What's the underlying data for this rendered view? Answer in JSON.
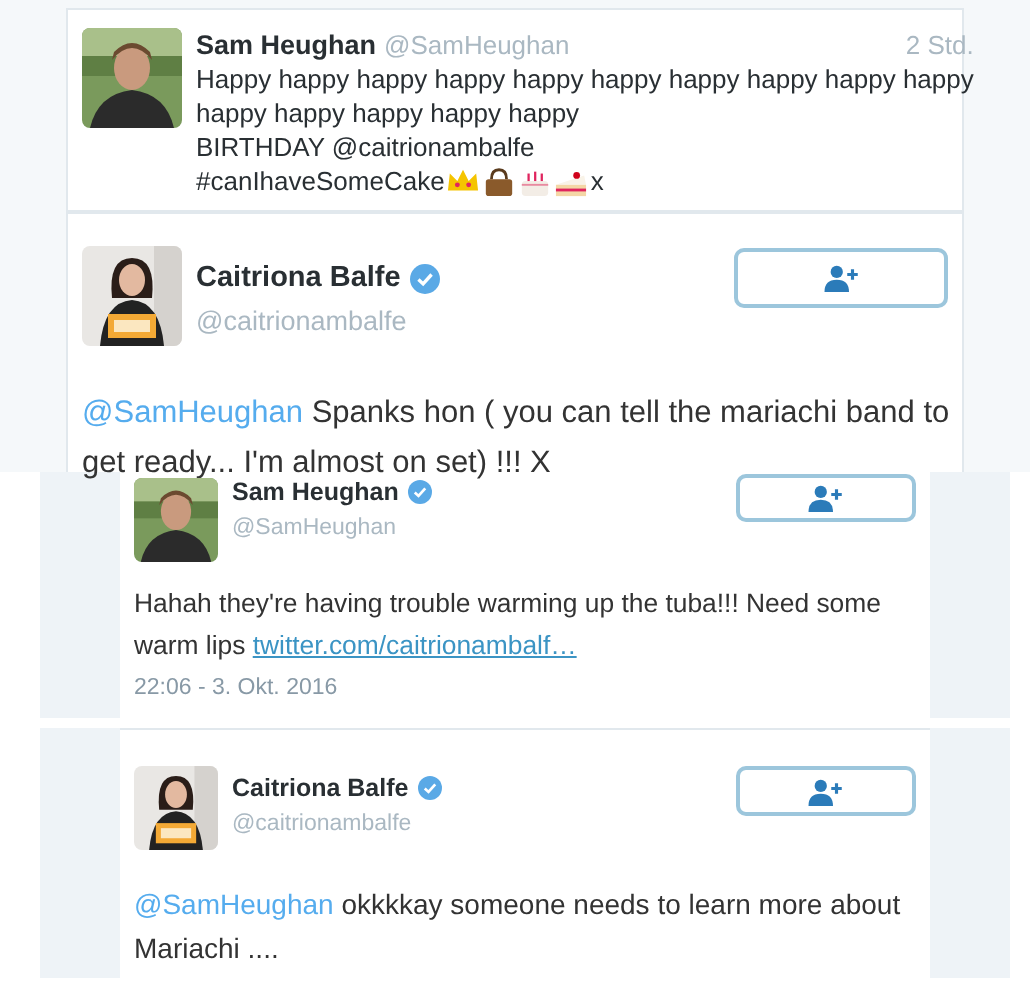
{
  "panels": [
    {
      "kind": "compact",
      "name": "Sam Heughan",
      "handle": "@SamHeughan",
      "time": "2 Std.",
      "lines": [
        "Happy happy happy happy happy happy happy happy happy happy",
        "happy happy happy happy happy",
        "BIRTHDAY @caitrionambalfe",
        "#canIhaveSomeCake"
      ],
      "sign_off": "x"
    },
    {
      "kind": "expanded",
      "name": "Caitriona Balfe",
      "verified": true,
      "handle": "@caitrionambalfe",
      "body": [
        {
          "kind": "mention",
          "text": "@SamHeughan"
        },
        {
          "kind": "plain",
          "text": " Spanks hon ( you can tell the mariachi band to get ready... I'm almost on set) !!! X"
        }
      ]
    },
    {
      "kind": "expanded",
      "name": "Sam Heughan",
      "verified": true,
      "handle": "@SamHeughan",
      "body": [
        {
          "kind": "plain",
          "text": "Hahah they're having trouble warming up the tuba!!! Need some warm lips "
        },
        {
          "kind": "link",
          "text": "twitter.com/caitrionambalf…"
        }
      ],
      "date": "22:06 - 3. Okt. 2016"
    },
    {
      "kind": "expanded",
      "name": "Caitriona Balfe",
      "verified": true,
      "handle": "@caitrionambalfe",
      "body": [
        {
          "kind": "mention",
          "text": "@SamHeughan"
        },
        {
          "kind": "plain",
          "text": " okkkkay someone needs to learn more about Mariachi ...."
        }
      ]
    }
  ]
}
